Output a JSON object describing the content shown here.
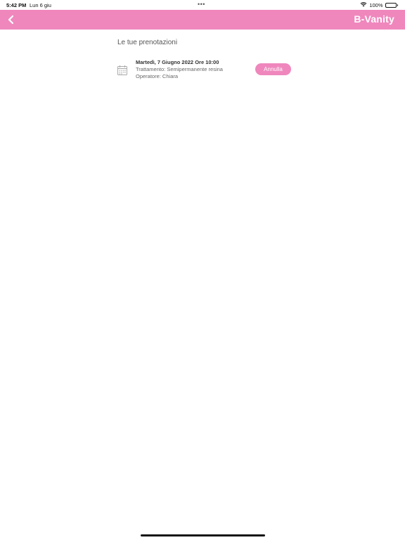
{
  "status_bar": {
    "time": "5:42 PM",
    "date": "Lun 6 giu",
    "dots": "•••",
    "battery": "100%",
    "battery_level": 1.0
  },
  "nav": {
    "title": "B-Vanity",
    "back_icon": "chevron-left-icon",
    "color": "#ef87bd"
  },
  "main": {
    "section_title": "Le tue prenotazioni",
    "bookings": [
      {
        "date": "Martedì, 7 Giugno 2022 Ore 10:00",
        "treatment": "Trattamento: Semipermanente resina",
        "operator": "Operatore: Chiara",
        "cancel_label": "Annulla",
        "icon": "calendar-icon"
      }
    ]
  }
}
